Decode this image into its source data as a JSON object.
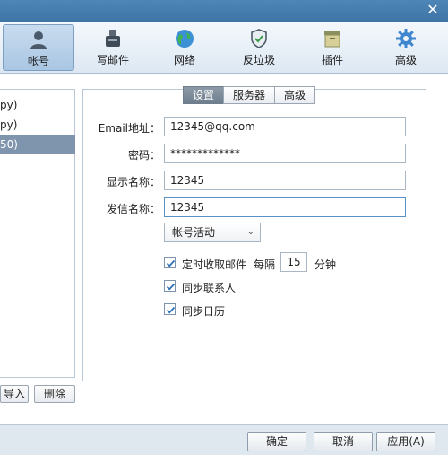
{
  "toolbar": {
    "items": [
      {
        "label": "帐号",
        "icon": "user-icon",
        "active": true
      },
      {
        "label": "写邮件",
        "icon": "compose-icon"
      },
      {
        "label": "网络",
        "icon": "globe-icon"
      },
      {
        "label": "反垃圾",
        "icon": "shield-icon"
      },
      {
        "label": "插件",
        "icon": "plugin-box-icon"
      },
      {
        "label": "高级",
        "icon": "gear-icon"
      }
    ]
  },
  "accounts": {
    "items": [
      "py)",
      "py)",
      "50)"
    ],
    "selected_index": 2,
    "import_label": "导入",
    "delete_label": "删除"
  },
  "tabs": [
    "设置",
    "服务器",
    "高级"
  ],
  "form": {
    "email_label": "Email地址：",
    "email_value": "12345@qq.com",
    "password_label": "密码：",
    "password_value": "*************",
    "display_label": "显示名称：",
    "display_value": "12345",
    "sender_label": "发信名称：",
    "sender_value": "12345",
    "account_activity": "帐号活动",
    "fetch_label": "定时收取邮件",
    "every_label": "每隔",
    "interval_value": "15",
    "minutes_label": "分钟",
    "sync_contacts_label": "同步联系人",
    "sync_calendar_label": "同步日历"
  },
  "buttons": {
    "ok": "确定",
    "cancel": "取消",
    "apply": "应用(A)"
  },
  "colors": {
    "titlebar": "#4f86b8",
    "selected_account": "#7f95ad",
    "active_tab": "#7a8997"
  }
}
